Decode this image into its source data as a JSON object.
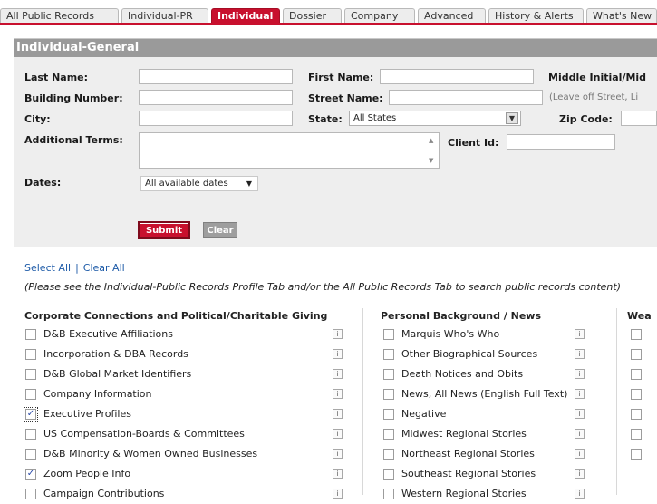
{
  "tabs": [
    {
      "label": "All Public Records",
      "active": false
    },
    {
      "label": "Individual-PR",
      "active": false
    },
    {
      "label": "Individual",
      "active": true
    },
    {
      "label": "Dossier",
      "active": false
    },
    {
      "label": "Company",
      "active": false
    },
    {
      "label": "Advanced",
      "active": false
    },
    {
      "label": "History & Alerts",
      "active": false
    },
    {
      "label": "What's New",
      "active": false
    }
  ],
  "panel": {
    "title": "Individual-General",
    "labels": {
      "last_name": "Last Name:",
      "first_name": "First Name:",
      "middle_initial": "Middle Initial/Mid",
      "building_number": "Building Number:",
      "street_name": "Street Name:",
      "street_hint": "(Leave off Street, Li",
      "city": "City:",
      "state": "State:",
      "zip_code": "Zip Code:",
      "additional_terms": "Additional Terms:",
      "client_id": "Client Id:",
      "dates": "Dates:"
    },
    "state_value": "All States",
    "dates_value": "All available dates",
    "submit_label": "Submit",
    "clear_label": "Clear"
  },
  "links": {
    "select_all": "Select All",
    "separator": "|",
    "clear_all": "Clear All"
  },
  "note": "(Please see the Individual-Public Records Profile Tab and/or the All Public Records Tab to search public records content)",
  "columns": {
    "corporate": {
      "title": "Corporate Connections and Political/Charitable Giving",
      "items": [
        {
          "label": "D&B Executive Affiliations",
          "checked": false
        },
        {
          "label": "Incorporation & DBA Records",
          "checked": false
        },
        {
          "label": "D&B Global Market Identifiers",
          "checked": false
        },
        {
          "label": "Company Information",
          "checked": false
        },
        {
          "label": "Executive Profiles",
          "checked": true
        },
        {
          "label": "US Compensation-Boards & Committees",
          "checked": false
        },
        {
          "label": "D&B Minority & Women Owned Businesses",
          "checked": false
        },
        {
          "label": "Zoom People Info",
          "checked": true
        },
        {
          "label": "Campaign Contributions",
          "checked": false
        }
      ]
    },
    "personal": {
      "title": "Personal Background / News",
      "items": [
        {
          "label": "Marquis Who's Who",
          "checked": false
        },
        {
          "label": "Other Biographical Sources",
          "checked": false
        },
        {
          "label": "Death Notices and Obits",
          "checked": false
        },
        {
          "label": "News, All News (English Full Text)",
          "checked": false
        },
        {
          "label": "Negative",
          "checked": false
        },
        {
          "label": "Midwest Regional Stories",
          "checked": false
        },
        {
          "label": "Northeast Regional Stories",
          "checked": false
        },
        {
          "label": "Southeast Regional Stories",
          "checked": false
        },
        {
          "label": "Western Regional Stories",
          "checked": false
        }
      ]
    },
    "wealth": {
      "title": "Wea"
    }
  },
  "info_glyph": "i",
  "check_glyph": "✓",
  "icons": {
    "info": "info-icon",
    "dropdown": "chevron-down-icon",
    "checkbox": "checkbox-icon"
  },
  "colors": {
    "accent": "#c8102e",
    "panel_header": "#9a9a9a",
    "panel_bg": "#eeeeee",
    "link": "#1e5ba8"
  }
}
